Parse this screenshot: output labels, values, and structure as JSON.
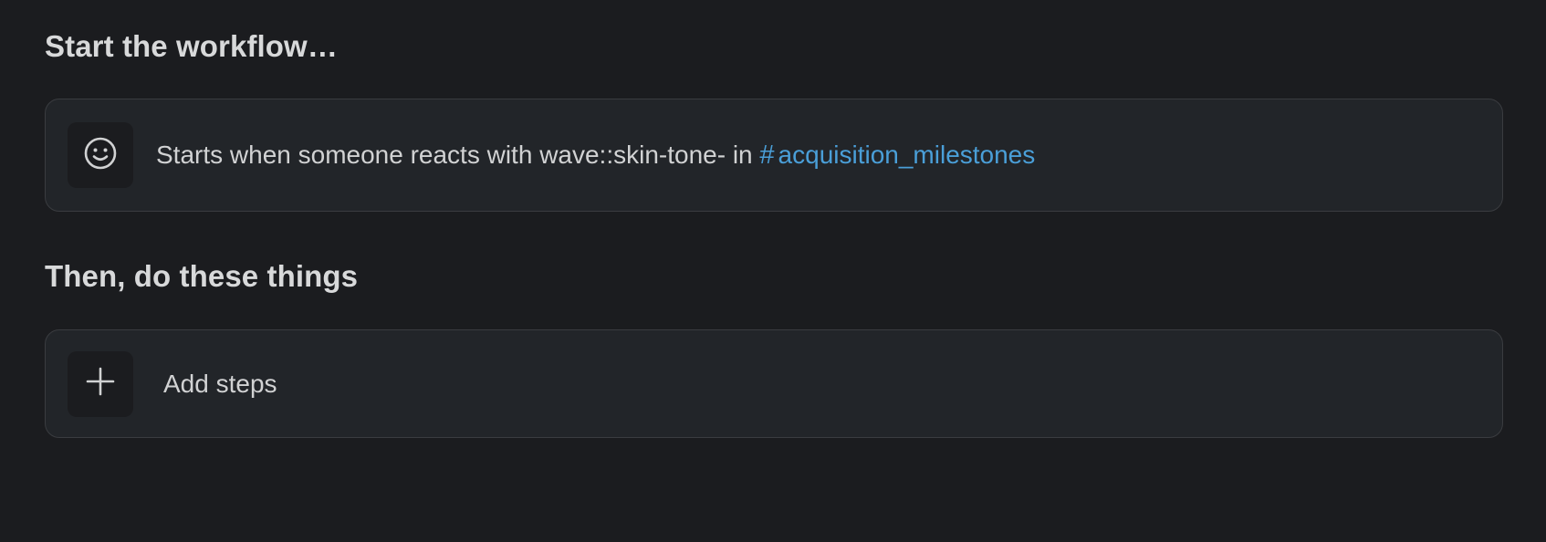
{
  "sections": {
    "start_title": "Start the workflow…",
    "then_title": "Then, do these things"
  },
  "trigger": {
    "icon": "smiley-face-icon",
    "text": "Starts when someone reacts with wave::skin-tone- in",
    "channel_hash": "#",
    "channel_name": "acquisition_milestones"
  },
  "steps": {
    "icon": "plus-icon",
    "add_label": "Add steps"
  },
  "colors": {
    "background": "#1b1c1f",
    "card": "#222529",
    "link": "#4a9fd8"
  }
}
